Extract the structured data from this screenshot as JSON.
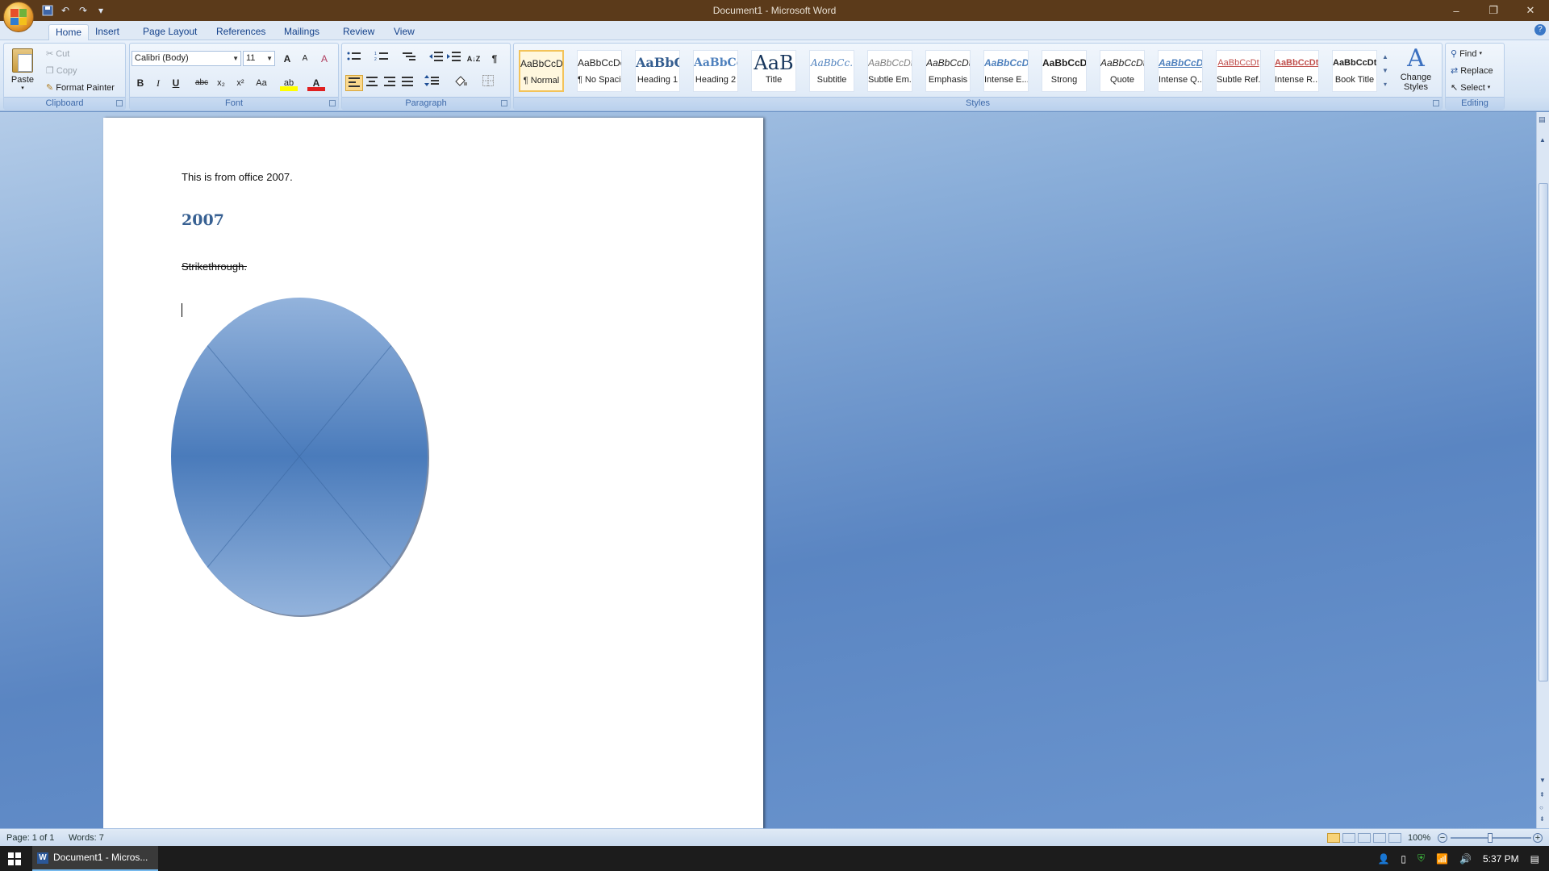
{
  "window": {
    "title": "Document1 - Microsoft Word",
    "minimize": "–",
    "restore": "❐",
    "close": "✕"
  },
  "qat": {
    "save": "💾",
    "undo": "↶",
    "redo": "↷",
    "customize": "▾"
  },
  "tabs": [
    "Home",
    "Insert",
    "Page Layout",
    "References",
    "Mailings",
    "Review",
    "View"
  ],
  "clipboard": {
    "paste": "Paste",
    "cut": "Cut",
    "copy": "Copy",
    "format_painter": "Format Painter",
    "label": "Clipboard"
  },
  "font": {
    "name": "Calibri (Body)",
    "size": "11",
    "label": "Font",
    "grow": "A",
    "shrink": "A",
    "clear": "A",
    "bold": "B",
    "italic": "I",
    "underline": "U",
    "strike": "abc",
    "subscript": "x₂",
    "superscript": "x²",
    "case": "Aa",
    "highlight": "ab",
    "color": "A"
  },
  "paragraph": {
    "label": "Paragraph",
    "pilcrow": "¶",
    "sort": "A↓Z"
  },
  "styles": {
    "label": "Styles",
    "items": [
      {
        "sample": "AaBbCcDc",
        "name": "¶ Normal"
      },
      {
        "sample": "AaBbCcDc",
        "name": "¶ No Spaci..."
      },
      {
        "sample": "AaBbC(",
        "name": "Heading 1"
      },
      {
        "sample": "AaBbCc",
        "name": "Heading 2"
      },
      {
        "sample": "AaB",
        "name": "Title"
      },
      {
        "sample": "AaBbCc.",
        "name": "Subtitle"
      },
      {
        "sample": "AaBbCcDt",
        "name": "Subtle Em..."
      },
      {
        "sample": "AaBbCcDt",
        "name": "Emphasis"
      },
      {
        "sample": "AaBbCcDt",
        "name": "Intense E..."
      },
      {
        "sample": "AaBbCcDt",
        "name": "Strong"
      },
      {
        "sample": "AaBbCcDt",
        "name": "Quote"
      },
      {
        "sample": "AaBbCcDt",
        "name": "Intense Q..."
      },
      {
        "sample": "AaBbCcDt",
        "name": "Subtle Ref..."
      },
      {
        "sample": "AaBbCcDt",
        "name": "Intense R..."
      },
      {
        "sample": "AaBbCcDt",
        "name": "Book Title"
      }
    ],
    "change_styles_1": "Change",
    "change_styles_2": "Styles"
  },
  "editing": {
    "label": "Editing",
    "find": "Find",
    "replace": "Replace",
    "select": "Select"
  },
  "document": {
    "line1": "This is from office 2007.",
    "heading": "2007",
    "strike_line": "Strikethrough."
  },
  "status": {
    "page": "Page: 1 of 1",
    "words": "Words: 7",
    "zoom": "100%"
  },
  "taskbar": {
    "app": "Document1 - Micros...",
    "time": "5:37 PM"
  },
  "colors": {
    "accent": "#15428b",
    "ribbon": "#dce8f6",
    "title_bar": "#5b3a1a",
    "heading": "#376092"
  }
}
